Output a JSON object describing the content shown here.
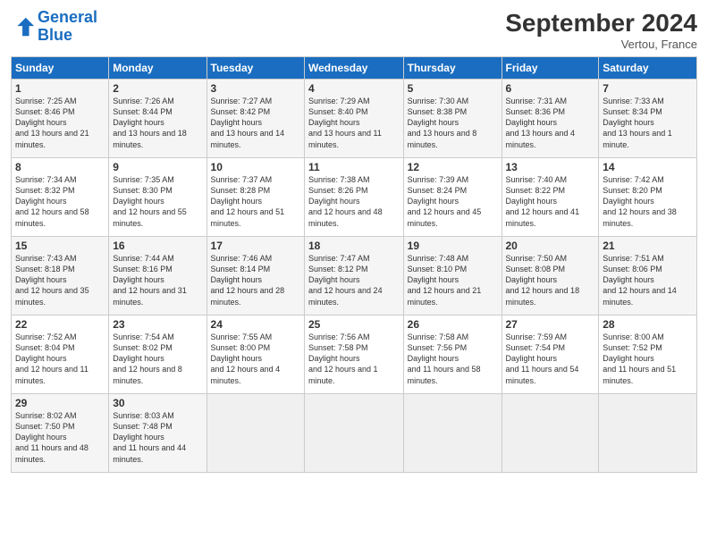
{
  "header": {
    "logo_line1": "General",
    "logo_line2": "Blue",
    "month_title": "September 2024",
    "location": "Vertou, France"
  },
  "days_of_week": [
    "Sunday",
    "Monday",
    "Tuesday",
    "Wednesday",
    "Thursday",
    "Friday",
    "Saturday"
  ],
  "weeks": [
    [
      {
        "num": "1",
        "sunrise": "7:25 AM",
        "sunset": "8:46 PM",
        "daylight": "13 hours and 21 minutes."
      },
      {
        "num": "2",
        "sunrise": "7:26 AM",
        "sunset": "8:44 PM",
        "daylight": "13 hours and 18 minutes."
      },
      {
        "num": "3",
        "sunrise": "7:27 AM",
        "sunset": "8:42 PM",
        "daylight": "13 hours and 14 minutes."
      },
      {
        "num": "4",
        "sunrise": "7:29 AM",
        "sunset": "8:40 PM",
        "daylight": "13 hours and 11 minutes."
      },
      {
        "num": "5",
        "sunrise": "7:30 AM",
        "sunset": "8:38 PM",
        "daylight": "13 hours and 8 minutes."
      },
      {
        "num": "6",
        "sunrise": "7:31 AM",
        "sunset": "8:36 PM",
        "daylight": "13 hours and 4 minutes."
      },
      {
        "num": "7",
        "sunrise": "7:33 AM",
        "sunset": "8:34 PM",
        "daylight": "13 hours and 1 minute."
      }
    ],
    [
      {
        "num": "8",
        "sunrise": "7:34 AM",
        "sunset": "8:32 PM",
        "daylight": "12 hours and 58 minutes."
      },
      {
        "num": "9",
        "sunrise": "7:35 AM",
        "sunset": "8:30 PM",
        "daylight": "12 hours and 55 minutes."
      },
      {
        "num": "10",
        "sunrise": "7:37 AM",
        "sunset": "8:28 PM",
        "daylight": "12 hours and 51 minutes."
      },
      {
        "num": "11",
        "sunrise": "7:38 AM",
        "sunset": "8:26 PM",
        "daylight": "12 hours and 48 minutes."
      },
      {
        "num": "12",
        "sunrise": "7:39 AM",
        "sunset": "8:24 PM",
        "daylight": "12 hours and 45 minutes."
      },
      {
        "num": "13",
        "sunrise": "7:40 AM",
        "sunset": "8:22 PM",
        "daylight": "12 hours and 41 minutes."
      },
      {
        "num": "14",
        "sunrise": "7:42 AM",
        "sunset": "8:20 PM",
        "daylight": "12 hours and 38 minutes."
      }
    ],
    [
      {
        "num": "15",
        "sunrise": "7:43 AM",
        "sunset": "8:18 PM",
        "daylight": "12 hours and 35 minutes."
      },
      {
        "num": "16",
        "sunrise": "7:44 AM",
        "sunset": "8:16 PM",
        "daylight": "12 hours and 31 minutes."
      },
      {
        "num": "17",
        "sunrise": "7:46 AM",
        "sunset": "8:14 PM",
        "daylight": "12 hours and 28 minutes."
      },
      {
        "num": "18",
        "sunrise": "7:47 AM",
        "sunset": "8:12 PM",
        "daylight": "12 hours and 24 minutes."
      },
      {
        "num": "19",
        "sunrise": "7:48 AM",
        "sunset": "8:10 PM",
        "daylight": "12 hours and 21 minutes."
      },
      {
        "num": "20",
        "sunrise": "7:50 AM",
        "sunset": "8:08 PM",
        "daylight": "12 hours and 18 minutes."
      },
      {
        "num": "21",
        "sunrise": "7:51 AM",
        "sunset": "8:06 PM",
        "daylight": "12 hours and 14 minutes."
      }
    ],
    [
      {
        "num": "22",
        "sunrise": "7:52 AM",
        "sunset": "8:04 PM",
        "daylight": "12 hours and 11 minutes."
      },
      {
        "num": "23",
        "sunrise": "7:54 AM",
        "sunset": "8:02 PM",
        "daylight": "12 hours and 8 minutes."
      },
      {
        "num": "24",
        "sunrise": "7:55 AM",
        "sunset": "8:00 PM",
        "daylight": "12 hours and 4 minutes."
      },
      {
        "num": "25",
        "sunrise": "7:56 AM",
        "sunset": "7:58 PM",
        "daylight": "12 hours and 1 minute."
      },
      {
        "num": "26",
        "sunrise": "7:58 AM",
        "sunset": "7:56 PM",
        "daylight": "11 hours and 58 minutes."
      },
      {
        "num": "27",
        "sunrise": "7:59 AM",
        "sunset": "7:54 PM",
        "daylight": "11 hours and 54 minutes."
      },
      {
        "num": "28",
        "sunrise": "8:00 AM",
        "sunset": "7:52 PM",
        "daylight": "11 hours and 51 minutes."
      }
    ],
    [
      {
        "num": "29",
        "sunrise": "8:02 AM",
        "sunset": "7:50 PM",
        "daylight": "11 hours and 48 minutes."
      },
      {
        "num": "30",
        "sunrise": "8:03 AM",
        "sunset": "7:48 PM",
        "daylight": "11 hours and 44 minutes."
      },
      null,
      null,
      null,
      null,
      null
    ]
  ]
}
